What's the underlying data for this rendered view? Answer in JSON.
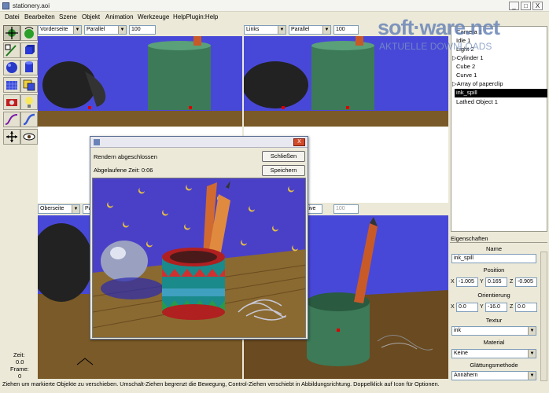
{
  "window": {
    "title": "stationery.aoi",
    "min_label": "_",
    "max_label": "□",
    "close_label": "X"
  },
  "menu": [
    "Datei",
    "Bearbeiten",
    "Szene",
    "Objekt",
    "Animation",
    "Werkzeuge",
    "HelpPlugin:Help"
  ],
  "tools": [
    "move-tool-icon",
    "rotate-tool-icon",
    "edit-tool-icon",
    "cube-tool-icon",
    "sphere-tool-icon",
    "cylinder-tool-icon",
    "grid-tool-icon",
    "polygon-tool-icon",
    "camera-tool-icon",
    "light-tool-icon",
    "curve-tool-icon",
    "tube-tool-icon",
    "pan-tool-icon",
    "eye-tool-icon"
  ],
  "viewports": {
    "top_left": {
      "view": "Vorderseite",
      "projection": "Parallel",
      "zoom": "100"
    },
    "top_right": {
      "view": "Links",
      "projection": "Parallel",
      "zoom": "100"
    },
    "bottom_left": {
      "view": "Oberseite",
      "projection": "Pa"
    },
    "bottom_right": {
      "view": "ktive",
      "zoom": "100"
    }
  },
  "tree": {
    "items": [
      {
        "label": "Camera 1",
        "expand": ""
      },
      {
        "label": "Idle 1",
        "expand": ""
      },
      {
        "label": "Light 2",
        "expand": ""
      },
      {
        "label": "Cylinder 1",
        "expand": "▷"
      },
      {
        "label": "Cube 2",
        "expand": ""
      },
      {
        "label": "Curve 1",
        "expand": ""
      },
      {
        "label": "Array of paperclip",
        "expand": "▷"
      },
      {
        "label": "ink_spill",
        "expand": "",
        "selected": true
      },
      {
        "label": "Lathed Object 1",
        "expand": ""
      }
    ]
  },
  "properties": {
    "header": "Eigenschaften",
    "name_label": "Name",
    "name_value": "ink_spill",
    "position_label": "Position",
    "pos_x_label": "X",
    "pos_x": "-1.005",
    "pos_y_label": "Y",
    "pos_y": "0.165",
    "pos_z_label": "Z",
    "pos_z": "-0.905",
    "orient_label": "Orientierung",
    "rot_x_label": "X",
    "rot_x": "0.0",
    "rot_y_label": "Y",
    "rot_y": "-16.0",
    "rot_z_label": "Z",
    "rot_z": "0.0",
    "texture_label": "Textur",
    "texture_value": "ink",
    "material_label": "Material",
    "material_value": "Keine",
    "smoothing_label": "Glättungsmethode",
    "smoothing_value": "Annähern"
  },
  "time_panel": {
    "time_label": "Zeit:",
    "time_value": "0.0",
    "frame_label": "Frame:",
    "frame_value": "0"
  },
  "dialog": {
    "status": "Rendern abgeschlossen",
    "elapsed": "Abgelaufene Zeit: 0:06",
    "close_button": "Schließen",
    "save_button": "Speichern",
    "close_label": "X"
  },
  "statusbar": "Ziehen um markierte Objekte zu verschieben. Umschalt-Ziehen begrenzt die Bewegung, Control-Ziehen verschiebt in Abbildungsrichtung. Doppelklick auf Icon für Optionen.",
  "watermark": {
    "main": "soft·ware.net",
    "sub": "AKTUELLE DOWNLOADS"
  },
  "colors": {
    "sky": "#4848d8",
    "floor": "#7a5a28",
    "cylinder": "#3c7a58",
    "selection": "#000000",
    "accent": "#316ac5"
  }
}
